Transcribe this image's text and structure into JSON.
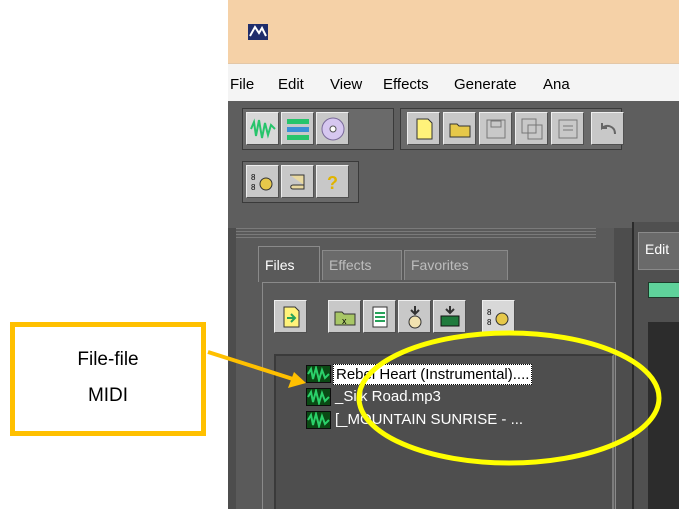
{
  "menu": {
    "items": [
      "File",
      "Edit",
      "View",
      "Effects",
      "Generate",
      "Ana"
    ]
  },
  "panel": {
    "tabs": [
      "Files",
      "Effects",
      "Favorites"
    ],
    "active_tab": "Files"
  },
  "files": [
    {
      "name": "Rebel Heart (Instrumental)....",
      "selected": true
    },
    {
      "name": "_Silk Road.mp3",
      "selected": false
    },
    {
      "name": "[_MOUNTAIN SUNRISE - ...",
      "selected": false
    }
  ],
  "editor": {
    "tab_label": "Edit"
  },
  "annotation": {
    "line1": "File-file",
    "line2": "MIDI"
  },
  "colors": {
    "annotation_yellow": "#ffc000",
    "highlight_ellipse": "#ffff00",
    "titlebar": "#f5d1a7",
    "wave_green": "#2bd16a"
  }
}
